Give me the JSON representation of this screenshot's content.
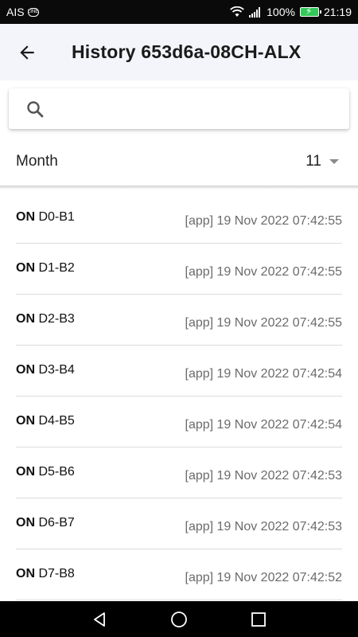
{
  "status_bar": {
    "carrier": "AIS",
    "message_icon_text": "LINE",
    "battery_percent": "100%",
    "time": "21:19"
  },
  "app_bar": {
    "title": "History 653d6a-08CH-ALX"
  },
  "search": {
    "placeholder": "",
    "value": ""
  },
  "filter": {
    "label": "Month",
    "selected": "11"
  },
  "history": [
    {
      "state": "ON",
      "channel": "D0-B1",
      "source_time": "[app] 19 Nov 2022 07:42:55"
    },
    {
      "state": "ON",
      "channel": "D1-B2",
      "source_time": "[app] 19 Nov 2022 07:42:55"
    },
    {
      "state": "ON",
      "channel": "D2-B3",
      "source_time": "[app] 19 Nov 2022 07:42:55"
    },
    {
      "state": "ON",
      "channel": "D3-B4",
      "source_time": "[app] 19 Nov 2022 07:42:54"
    },
    {
      "state": "ON",
      "channel": "D4-B5",
      "source_time": "[app] 19 Nov 2022 07:42:54"
    },
    {
      "state": "ON",
      "channel": "D5-B6",
      "source_time": "[app] 19 Nov 2022 07:42:53"
    },
    {
      "state": "ON",
      "channel": "D6-B7",
      "source_time": "[app] 19 Nov 2022 07:42:53"
    },
    {
      "state": "ON",
      "channel": "D7-B8",
      "source_time": "[app] 19 Nov 2022 07:42:52"
    }
  ],
  "icons": {
    "back": "arrow-left-icon",
    "search": "search-icon",
    "dropdown": "caret-down-icon",
    "nav_back": "triangle-back-icon",
    "nav_home": "circle-home-icon",
    "nav_recents": "square-recents-icon"
  },
  "colors": {
    "app_bar_bg": "#f3f5fa",
    "battery": "#34c759",
    "divider": "#dcdcdc",
    "timestamp": "#6b6b6b"
  }
}
